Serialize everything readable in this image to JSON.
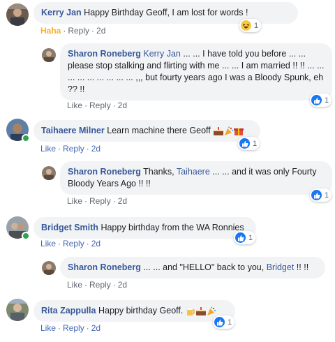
{
  "comments": [
    {
      "author": "Kerry Jan",
      "text": "Happy Birthday Geoff, I am lost for words !",
      "actions": {
        "reaction": "Haha",
        "reply": "Reply",
        "time": "2d"
      },
      "reaction_count": "1",
      "reaction_type": "haha-icon"
    },
    {
      "author": "Sharon Roneberg",
      "mention": "Kerry Jan",
      "text": "... ... I have told you before ... ... please stop stalking and flirting with me ... ... I am married !! !! ... ... ... ... ... ... ... ... ... ,,, but fourty years ago I was a Bloody Spunk, eh ?? !!",
      "actions": {
        "like": "Like",
        "reply": "Reply",
        "time": "2d"
      },
      "reaction_count": "1",
      "reaction_type": "like-icon"
    },
    {
      "author": "Taihaere Milner",
      "text": "Learn machine there Geoff",
      "emoji": "cake party gift",
      "actions": {
        "like": "Like",
        "reply": "Reply",
        "time": "2d"
      },
      "reaction_count": "1",
      "reaction_type": "like-icon"
    },
    {
      "author": "Sharon Roneberg",
      "text_before": "Thanks,",
      "mention": "Taihaere",
      "text": "... ... and it was only Fourty Bloody Years Ago !! !!",
      "actions": {
        "like": "Like",
        "reply": "Reply",
        "time": "2d"
      },
      "reaction_count": "1",
      "reaction_type": "like-icon"
    },
    {
      "author": "Bridget Smith",
      "text": "Happy birthday from the WA Ronnies",
      "actions": {
        "like": "Like",
        "reply": "Reply",
        "time": "2d"
      },
      "reaction_count": "1",
      "reaction_type": "like-icon"
    },
    {
      "author": "Sharon Roneberg",
      "text_before": "... ... and \"HELLO\" back to you,",
      "mention": "Bridget",
      "text": "!! !!",
      "actions": {
        "like": "Like",
        "reply": "Reply",
        "time": "2d"
      }
    },
    {
      "author": "Rita Zappulla",
      "text": "Happy birthday Geoff.",
      "emoji": "beer cake party",
      "actions": {
        "like": "Like",
        "reply": "Reply",
        "time": "2d"
      },
      "reaction_count": "1",
      "reaction_type": "like-icon"
    }
  ],
  "colors": {
    "link": "#385898",
    "like": "#4267b2",
    "haha": "#f7b125",
    "bubble": "#f2f3f5",
    "online": "#31a24c"
  }
}
